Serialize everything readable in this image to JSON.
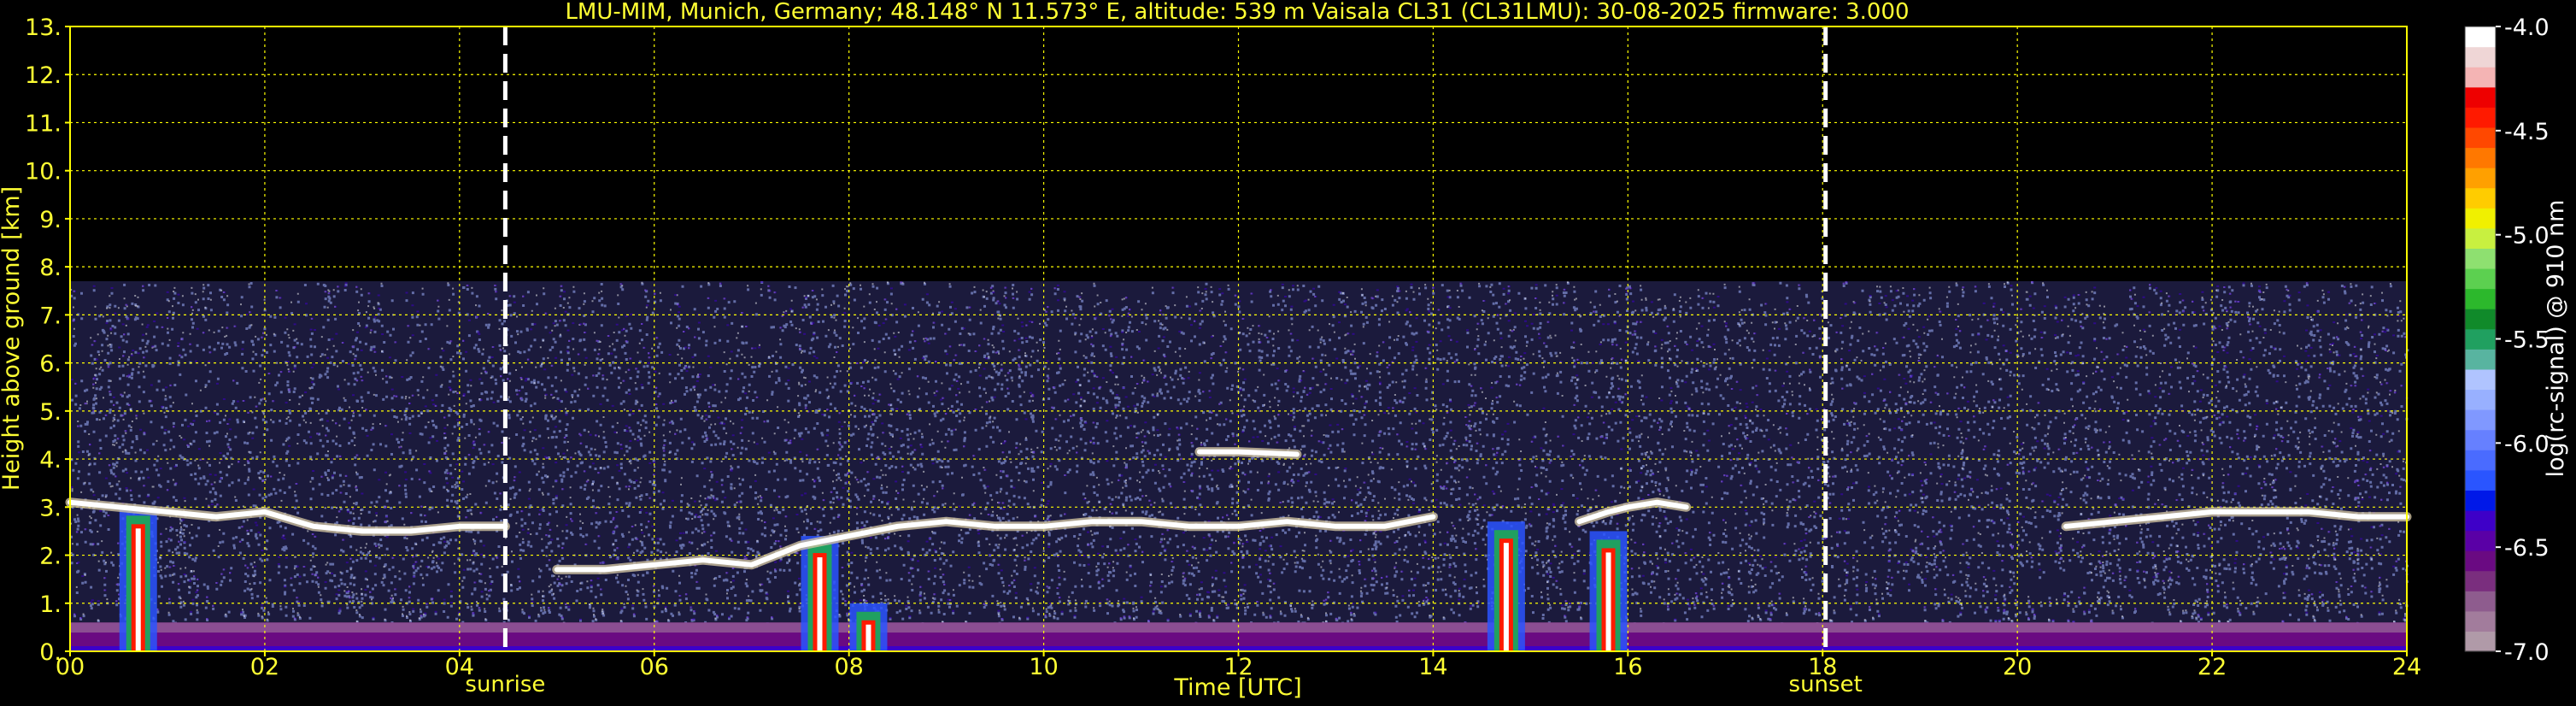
{
  "colors": {
    "background": "#000000",
    "grid": "#ffff00",
    "text": "#ffff33",
    "daylight_markers": "#ffffff",
    "colorbar_text": "#ffffff"
  },
  "chart_data": {
    "type": "heatmap",
    "title": "LMU-MIM, Munich, Germany; 48.148° N 11.573° E, altitude: 539 m    Vaisala CL31 (CL31LMU): 30-08-2025    firmware: 3.000",
    "xlabel": "Time [UTC]",
    "ylabel": "Height above ground [km]",
    "xlim": [
      0,
      24
    ],
    "ylim": [
      0,
      13
    ],
    "x_ticks": [
      "00",
      "02",
      "04",
      "06",
      "08",
      "10",
      "12",
      "14",
      "16",
      "18",
      "20",
      "22",
      "24"
    ],
    "y_ticks": [
      "0.",
      "1.",
      "2.",
      "3.",
      "4.",
      "5.",
      "6.",
      "7.",
      "8.",
      "9.",
      "10.",
      "11.",
      "12.",
      "13."
    ],
    "grid": true,
    "markers": [
      {
        "label": "sunrise",
        "x": 4.47
      },
      {
        "label": "sunset",
        "x": 18.03
      }
    ],
    "signal_top_km": 7.7,
    "aerosol_layer_top_km": 0.6,
    "cloud_layers": [
      {
        "x": [
          0.0,
          0.5,
          1.0,
          1.5,
          2.0,
          2.5,
          3.0,
          3.5,
          4.0,
          4.47
        ],
        "height_km": [
          3.1,
          3.0,
          2.9,
          2.8,
          2.9,
          2.6,
          2.5,
          2.5,
          2.6,
          2.6
        ]
      },
      {
        "x": [
          5.0,
          5.5,
          6.0,
          6.5,
          7.0,
          7.5,
          8.0,
          8.5,
          9.0,
          9.5,
          10.0,
          10.5,
          11.0,
          11.5,
          12.0,
          12.5,
          13.0,
          13.5,
          14.0
        ],
        "height_km": [
          1.7,
          1.7,
          1.8,
          1.9,
          1.8,
          2.2,
          2.4,
          2.6,
          2.7,
          2.6,
          2.6,
          2.7,
          2.7,
          2.6,
          2.6,
          2.7,
          2.6,
          2.6,
          2.8
        ]
      },
      {
        "x": [
          15.5,
          15.8,
          16.0,
          16.3,
          16.6
        ],
        "height_km": [
          2.7,
          2.9,
          3.0,
          3.1,
          3.0
        ]
      },
      {
        "x": [
          20.5,
          21.0,
          21.5,
          22.0,
          22.5,
          23.0,
          23.5,
          24.0
        ],
        "height_km": [
          2.6,
          2.7,
          2.8,
          2.9,
          2.9,
          2.9,
          2.8,
          2.8
        ]
      },
      {
        "x": [
          11.6,
          12.0,
          12.6
        ],
        "height_km": [
          4.15,
          4.15,
          4.1
        ]
      }
    ],
    "precip_columns": [
      {
        "x": 0.7,
        "top_km": 3.0
      },
      {
        "x": 7.7,
        "top_km": 2.4
      },
      {
        "x": 8.2,
        "top_km": 1.0
      },
      {
        "x": 14.75,
        "top_km": 2.7
      },
      {
        "x": 15.8,
        "top_km": 2.5
      }
    ],
    "colorbar": {
      "label": "log(rc-signal) @ 910 nm",
      "range": [
        -7.0,
        -4.0
      ],
      "tick_labels": [
        "-4.0",
        "-4.5",
        "-5.0",
        "-5.5",
        "-6.0",
        "-6.5",
        "-7.0"
      ],
      "tick_values": [
        -4.0,
        -4.5,
        -5.0,
        -5.5,
        -6.0,
        -6.5,
        -7.0
      ],
      "colors_bottom_to_top": [
        "#b09aa8",
        "#a27c9c",
        "#8e5c8e",
        "#7a2e7e",
        "#6a0a82",
        "#5a00a6",
        "#3e00c8",
        "#0018e8",
        "#2a55ff",
        "#4a6bff",
        "#6680ff",
        "#8098ff",
        "#98b0ff",
        "#b0c4ff",
        "#58b4a0",
        "#20a060",
        "#108a2a",
        "#2cb82c",
        "#5cd050",
        "#8ee070",
        "#c8f040",
        "#f0f000",
        "#ffcc00",
        "#ffa000",
        "#ff7800",
        "#ff4800",
        "#ff1a00",
        "#ee0000",
        "#f4b4b4",
        "#efd6d6",
        "#ffffff"
      ]
    }
  }
}
